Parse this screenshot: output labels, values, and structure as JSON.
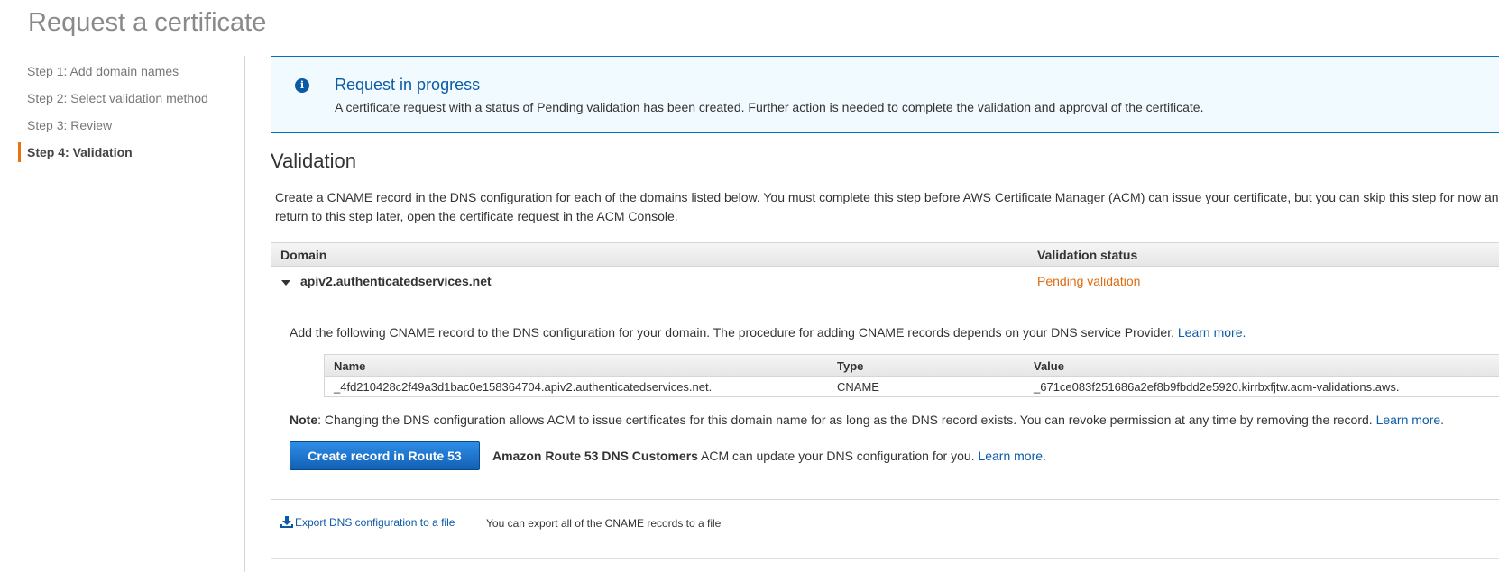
{
  "page": {
    "title": "Request a certificate"
  },
  "steps": [
    {
      "label": "Step 1: Add domain names"
    },
    {
      "label": "Step 2: Select validation method"
    },
    {
      "label": "Step 3: Review"
    },
    {
      "label": "Step 4: Validation",
      "active": true
    }
  ],
  "alert": {
    "icon": "info-icon",
    "title": "Request in progress",
    "text": "A certificate request with a status of Pending validation has been created. Further action is needed to complete the validation and approval of the certificate."
  },
  "validation": {
    "title": "Validation",
    "intro": "Create a CNAME record in the DNS configuration for each of the domains listed below. You must complete this step before AWS Certificate Manager (ACM) can issue your certificate, but you can skip this step for now and return to this step later, open the certificate request in the ACM Console.",
    "columns": {
      "domain": "Domain",
      "status": "Validation status"
    },
    "domain": {
      "name": "apiv2.authenticatedservices.net",
      "status": "Pending validation",
      "add_text": "Add the following CNAME record to the DNS configuration for your domain. The procedure for adding CNAME records depends on your DNS service Provider.",
      "learn_more": "Learn more.",
      "record_columns": {
        "name": "Name",
        "type": "Type",
        "value": "Value"
      },
      "record": {
        "name": "_4fd210428c2f49a3d1bac0e158364704.apiv2.authenticatedservices.net.",
        "type": "CNAME",
        "value": "_671ce083f251686a2ef8b9fbdd2e5920.kirrbxfjtw.acm-validations.aws."
      },
      "note_label": "Note",
      "note_text": ": Changing the DNS configuration allows ACM to issue certificates for this domain name for as long as the DNS record exists. You can revoke permission at any time by removing the record.",
      "note_learn_more": "Learn more.",
      "route53_button": "Create record in Route 53",
      "route53_bold": "Amazon Route 53 DNS Customers",
      "route53_text": " ACM can update your DNS configuration for you.",
      "route53_learn_more": "Learn more."
    }
  },
  "export": {
    "icon": "download-icon",
    "link": "Export DNS configuration to a file",
    "description": "You can export all of the CNAME records to a file"
  },
  "colors": {
    "accent": "#ec7211",
    "link": "#0b5aa6",
    "pending": "#dd6b10",
    "alert_border": "#0073bb"
  }
}
